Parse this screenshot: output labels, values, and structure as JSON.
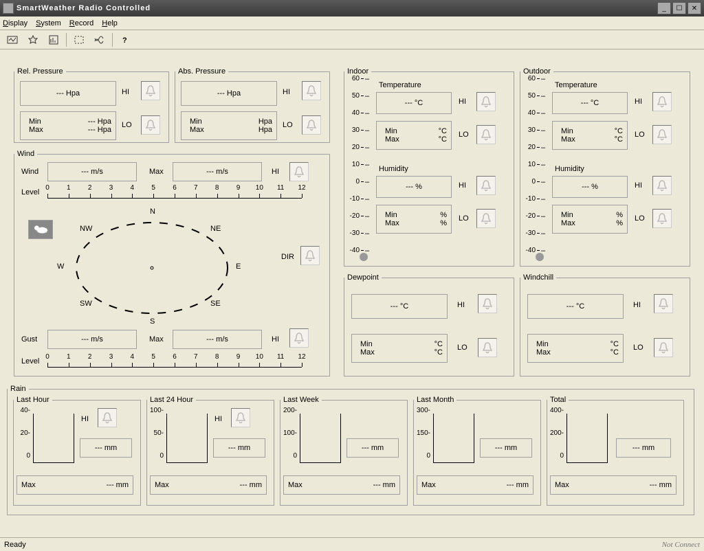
{
  "app": {
    "title": "SmartWeather Radio Controlled"
  },
  "menu": {
    "display": "Display",
    "system": "System",
    "record": "Record",
    "help": "Help"
  },
  "status": {
    "ready": "Ready",
    "connect": "Not Connect"
  },
  "labels": {
    "hi": "HI",
    "lo": "LO",
    "min": "Min",
    "max": "Max",
    "dir": "DIR",
    "wind": "Wind",
    "gust": "Gust",
    "level": "Level",
    "n": "N",
    "ne": "NE",
    "e": "E",
    "se": "SE",
    "s": "S",
    "sw": "SW",
    "w": "W",
    "nw": "NW"
  },
  "pressure": {
    "rel": {
      "legend": "Rel. Pressure",
      "value": "--- Hpa",
      "min": "--- Hpa",
      "max": "--- Hpa"
    },
    "abs": {
      "legend": "Abs. Pressure",
      "value": "--- Hpa",
      "min": "Hpa",
      "max": "Hpa"
    }
  },
  "wind": {
    "legend": "Wind",
    "speed": "--- m/s",
    "max_speed": "--- m/s",
    "gust": "--- m/s",
    "max_gust": "--- m/s"
  },
  "indoor": {
    "legend": "Indoor",
    "temp_label": "Temperature",
    "temp_value": "--- °C",
    "temp_min_unit": "°C",
    "temp_max_unit": "°C",
    "humid_label": "Humidity",
    "humid_value": "--- %",
    "humid_min_unit": "%",
    "humid_max_unit": "%"
  },
  "outdoor": {
    "legend": "Outdoor",
    "temp_label": "Temperature",
    "temp_value": "--- °C",
    "temp_min_unit": "°C",
    "temp_max_unit": "°C",
    "humid_label": "Humidity",
    "humid_value": "--- %",
    "humid_min_unit": "%",
    "humid_max_unit": "%"
  },
  "dewpoint": {
    "legend": "Dewpoint",
    "value": "--- °C",
    "min_unit": "°C",
    "max_unit": "°C"
  },
  "windchill": {
    "legend": "Windchill",
    "value": "--- °C",
    "min_unit": "°C",
    "max_unit": "°C"
  },
  "rain": {
    "legend": "Rain",
    "last_hour": {
      "legend": "Last Hour",
      "scale": [
        "40",
        "20",
        "0"
      ],
      "value": "--- mm",
      "max": "--- mm"
    },
    "last_24": {
      "legend": "Last 24 Hour",
      "scale": [
        "100",
        "50",
        "0"
      ],
      "value": "--- mm",
      "max": "--- mm"
    },
    "last_week": {
      "legend": "Last Week",
      "scale": [
        "200",
        "100",
        "0"
      ],
      "value": "--- mm",
      "max": "--- mm"
    },
    "last_month": {
      "legend": "Last Month",
      "scale": [
        "300",
        "150",
        "0"
      ],
      "value": "--- mm",
      "max": "--- mm"
    },
    "total": {
      "legend": "Total",
      "scale": [
        "400",
        "200",
        "0"
      ],
      "value": "--- mm",
      "max": "--- mm"
    }
  },
  "thermo_scale": [
    "60",
    "50",
    "40",
    "30",
    "20",
    "10",
    "0",
    "-10",
    "-20",
    "-30",
    "-40"
  ]
}
